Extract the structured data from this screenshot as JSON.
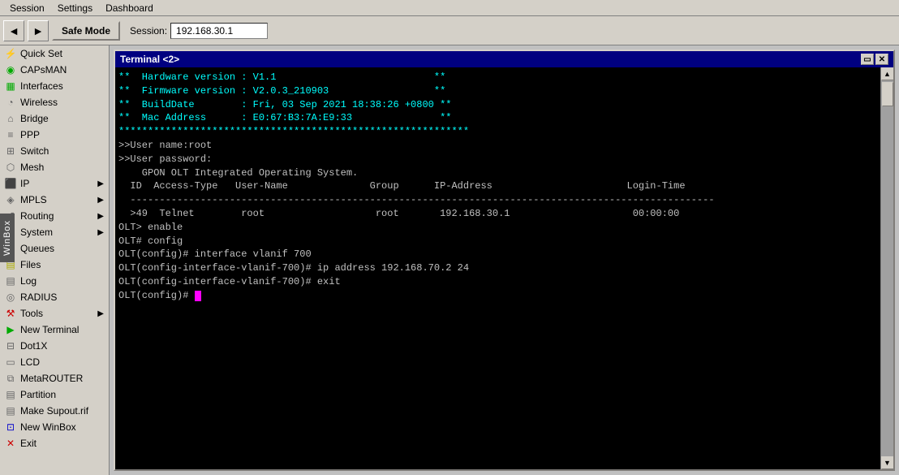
{
  "menubar": {
    "items": [
      {
        "id": "session",
        "label": "Session"
      },
      {
        "id": "settings",
        "label": "Settings"
      },
      {
        "id": "dashboard",
        "label": "Dashboard"
      }
    ]
  },
  "toolbar": {
    "back_icon": "◄",
    "forward_icon": "►",
    "safe_mode_label": "Safe Mode",
    "session_label": "Session:",
    "session_value": "192.168.30.1"
  },
  "sidebar": {
    "items": [
      {
        "id": "quick-set",
        "label": "Quick Set",
        "icon": "⚡",
        "icon_class": "icon-orange",
        "has_arrow": false
      },
      {
        "id": "capsman",
        "label": "CAPsMAN",
        "icon": "📡",
        "icon_class": "icon-green",
        "has_arrow": false
      },
      {
        "id": "interfaces",
        "label": "Interfaces",
        "icon": "▦",
        "icon_class": "icon-green",
        "has_arrow": false
      },
      {
        "id": "wireless",
        "label": "Wireless",
        "icon": "((•))",
        "icon_class": "icon-gray",
        "has_arrow": false
      },
      {
        "id": "bridge",
        "label": "Bridge",
        "icon": "🔗",
        "icon_class": "icon-gray",
        "has_arrow": false
      },
      {
        "id": "ppp",
        "label": "PPP",
        "icon": "≡",
        "icon_class": "icon-gray",
        "has_arrow": false
      },
      {
        "id": "switch",
        "label": "Switch",
        "icon": "⊞",
        "icon_class": "icon-gray",
        "has_arrow": false
      },
      {
        "id": "mesh",
        "label": "Mesh",
        "icon": "⬡",
        "icon_class": "icon-gray",
        "has_arrow": false
      },
      {
        "id": "ip",
        "label": "IP",
        "icon": "IP",
        "icon_class": "icon-gray",
        "has_arrow": true
      },
      {
        "id": "mpls",
        "label": "MPLS",
        "icon": "◈",
        "icon_class": "icon-gray",
        "has_arrow": true
      },
      {
        "id": "routing",
        "label": "Routing",
        "icon": "↔",
        "icon_class": "icon-gray",
        "has_arrow": true
      },
      {
        "id": "system",
        "label": "System",
        "icon": "⚙",
        "icon_class": "icon-gray",
        "has_arrow": true
      },
      {
        "id": "queues",
        "label": "Queues",
        "icon": "≋",
        "icon_class": "icon-orange",
        "has_arrow": false
      },
      {
        "id": "files",
        "label": "Files",
        "icon": "📁",
        "icon_class": "icon-yellow",
        "has_arrow": false
      },
      {
        "id": "log",
        "label": "Log",
        "icon": "📋",
        "icon_class": "icon-gray",
        "has_arrow": false
      },
      {
        "id": "radius",
        "label": "RADIUS",
        "icon": "👥",
        "icon_class": "icon-gray",
        "has_arrow": false
      },
      {
        "id": "tools",
        "label": "Tools",
        "icon": "🔧",
        "icon_class": "icon-red",
        "has_arrow": true
      },
      {
        "id": "new-terminal",
        "label": "New Terminal",
        "icon": "▶",
        "icon_class": "icon-green",
        "has_arrow": false
      },
      {
        "id": "dot1x",
        "label": "Dot1X",
        "icon": "⊟",
        "icon_class": "icon-gray",
        "has_arrow": false
      },
      {
        "id": "lcd",
        "label": "LCD",
        "icon": "▭",
        "icon_class": "icon-gray",
        "has_arrow": false
      },
      {
        "id": "metarouter",
        "label": "MetaROUTER",
        "icon": "⧉",
        "icon_class": "icon-gray",
        "has_arrow": false
      },
      {
        "id": "partition",
        "label": "Partition",
        "icon": "⊞",
        "icon_class": "icon-gray",
        "has_arrow": false
      },
      {
        "id": "make-supout",
        "label": "Make Supout.rif",
        "icon": "📄",
        "icon_class": "icon-gray",
        "has_arrow": false
      },
      {
        "id": "new-winbox",
        "label": "New WinBox",
        "icon": "🖥",
        "icon_class": "icon-blue",
        "has_arrow": false
      },
      {
        "id": "exit",
        "label": "Exit",
        "icon": "✕",
        "icon_class": "icon-red",
        "has_arrow": false
      }
    ]
  },
  "terminal": {
    "title": "Terminal <2>",
    "lines": [
      {
        "text": "**  Hardware version : V1.1                           **",
        "class": "line-cyan"
      },
      {
        "text": "**  Firmware version : V2.0.3_210903                  **",
        "class": "line-cyan"
      },
      {
        "text": "**  BuildDate        : Fri, 03 Sep 2021 18:38:26 +0800 **",
        "class": "line-cyan"
      },
      {
        "text": "**  Mac Address      : E0:67:B3:7A:E9:33               **",
        "class": "line-cyan"
      },
      {
        "text": "************************************************************",
        "class": "line-cyan"
      },
      {
        "text": "",
        "class": "line-gray"
      },
      {
        "text": ">>User name:root",
        "class": "line-gray"
      },
      {
        "text": ">>User password:",
        "class": "line-gray"
      },
      {
        "text": "",
        "class": "line-gray"
      },
      {
        "text": "    GPON OLT Integrated Operating System.",
        "class": "line-gray"
      },
      {
        "text": "",
        "class": "line-gray"
      },
      {
        "text": "  ID  Access-Type   User-Name              Group      IP-Address                       Login-Time",
        "class": "line-gray"
      },
      {
        "text": "  ----------------------------------------------------------------------------------------------------",
        "class": "line-gray"
      },
      {
        "text": "  >49  Telnet        root                   root       192.168.30.1                     00:00:00",
        "class": "line-gray"
      },
      {
        "text": "",
        "class": "line-gray"
      },
      {
        "text": "OLT> enable",
        "class": "line-gray"
      },
      {
        "text": "",
        "class": "line-gray"
      },
      {
        "text": "OLT# config",
        "class": "line-gray"
      },
      {
        "text": "",
        "class": "line-gray"
      },
      {
        "text": "OLT(config)# interface vlanif 700",
        "class": "line-gray"
      },
      {
        "text": "",
        "class": "line-gray"
      },
      {
        "text": "OLT(config-interface-vlanif-700)# ip address 192.168.70.2 24",
        "class": "line-gray"
      },
      {
        "text": "",
        "class": "line-gray"
      },
      {
        "text": "OLT(config-interface-vlanif-700)# exit",
        "class": "line-gray"
      },
      {
        "text": "",
        "class": "line-gray"
      },
      {
        "text": "OLT(config)# ",
        "class": "line-gray",
        "has_cursor": true
      }
    ]
  },
  "winbox": {
    "label": "WinBox"
  }
}
